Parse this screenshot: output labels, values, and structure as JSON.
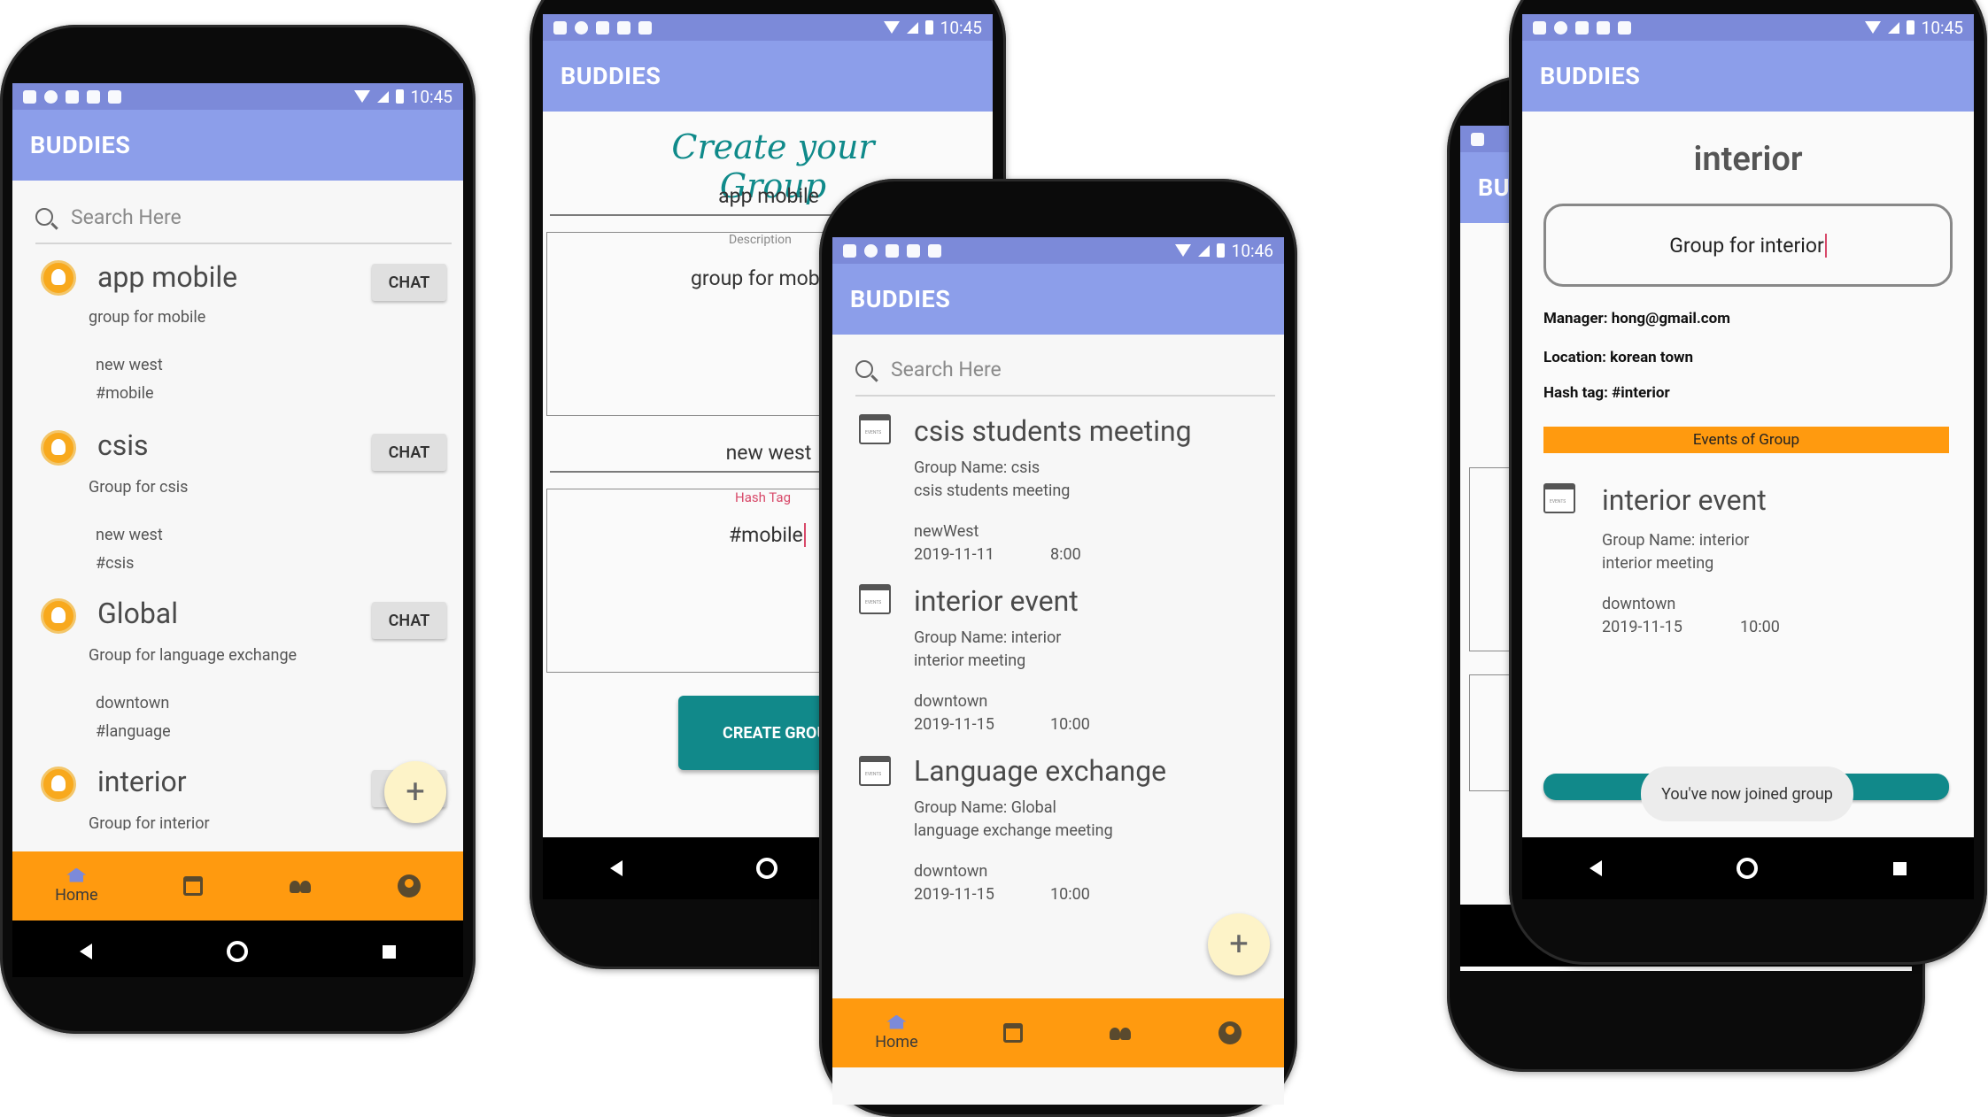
{
  "app_title": "BUDDIES",
  "status_time_a": "10:45",
  "status_time_b": "10:46",
  "search_placeholder": "Search Here",
  "chat_label": "CHAT",
  "fab_label": "+",
  "nav": {
    "home": "Home"
  },
  "groups": [
    {
      "name": "app mobile",
      "desc": "group for mobile",
      "location": "new west",
      "tag": "#mobile"
    },
    {
      "name": "csis",
      "desc": "Group for csis",
      "location": "new west",
      "tag": "#csis"
    },
    {
      "name": "Global",
      "desc": "Group for language exchange",
      "location": "downtown",
      "tag": "#language"
    },
    {
      "name": "interior",
      "desc": "Group for interior"
    }
  ],
  "create": {
    "title": "Create your Group",
    "name_value": "app mobile",
    "desc_label": "Description",
    "desc_value": "group for mobi",
    "location_value": "new west",
    "hashtag_label": "Hash Tag",
    "hashtag_value": "#mobile",
    "button": "CREATE GROUP"
  },
  "events": [
    {
      "title": "csis students meeting",
      "group": "Group Name: csis",
      "desc": "csis students meeting",
      "location": "newWest",
      "date": "2019-11-11",
      "time": "8:00"
    },
    {
      "title": "interior event",
      "group": "Group Name: interior",
      "desc": "interior meeting",
      "location": "downtown",
      "date": "2019-11-15",
      "time": "10:00"
    },
    {
      "title": "Language exchange",
      "group": "Group Name: Global",
      "desc": "language exchange meeting",
      "location": "downtown",
      "date": "2019-11-15",
      "time": "10:00"
    }
  ],
  "detail": {
    "title": "interior",
    "desc_value": "Group for interior",
    "manager": "Manager: hong@gmail.com",
    "location": "Location: korean town",
    "hashtag": "Hash tag: #interior",
    "events_header": "Events of Group",
    "event": {
      "title": "interior event",
      "group": "Group Name: interior",
      "desc": "interior meeting",
      "location": "downtown",
      "date": "2019-11-15",
      "time": "10:00"
    },
    "toast": "You've now joined group",
    "back_appbar_partial": "BU"
  },
  "colors": {
    "appbar": "#8c9eea",
    "statusbar": "#7c8ad9",
    "bottomnav": "#ff9a0f",
    "teal": "#11898a",
    "fab": "#fdf3c8"
  }
}
